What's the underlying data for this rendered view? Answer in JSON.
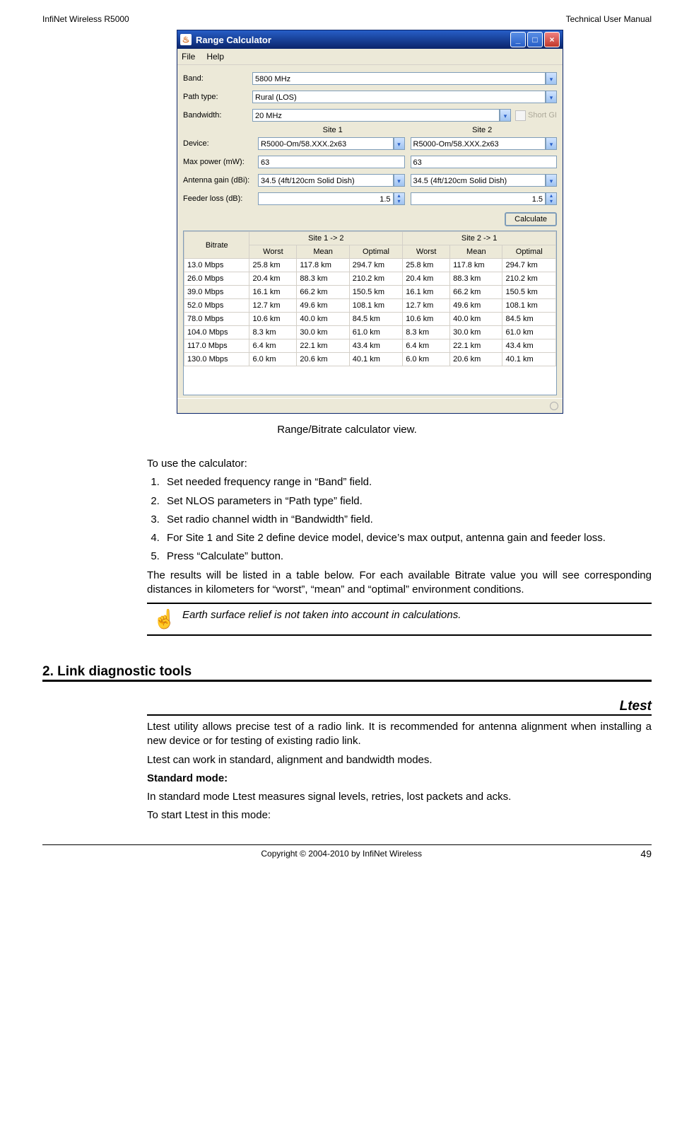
{
  "header": {
    "left": "InfiNet Wireless R5000",
    "right": "Technical User Manual"
  },
  "footer": {
    "center": "Copyright © 2004-2010 by InfiNet Wireless",
    "page": "49"
  },
  "calc_window": {
    "title": "Range Calculator",
    "menu": {
      "file": "File",
      "help": "Help"
    },
    "labels": {
      "band": "Band:",
      "path": "Path type:",
      "bw": "Bandwidth:",
      "short_gi": "Short GI",
      "site1": "Site 1",
      "site2": "Site 2",
      "device": "Device:",
      "maxpower": "Max power (mW):",
      "antgain": "Antenna gain (dBi):",
      "feeder": "Feeder loss (dB):",
      "calculate": "Calculate"
    },
    "values": {
      "band": "5800 MHz",
      "path": "Rural (LOS)",
      "bw": "20 MHz",
      "device1": "R5000-Om/58.XXX.2x63",
      "device2": "R5000-Om/58.XXX.2x63",
      "power1": "63",
      "power2": "63",
      "ant1": "34.5 (4ft/120cm Solid Dish)",
      "ant2": "34.5 (4ft/120cm Solid Dish)",
      "feeder1": "1.5",
      "feeder2": "1.5"
    },
    "table_headers": {
      "bitrate": "Bitrate",
      "s12": "Site 1 -> 2",
      "s21": "Site 2 -> 1",
      "worst": "Worst",
      "mean": "Mean",
      "optimal": "Optimal"
    }
  },
  "chart_data": {
    "type": "table",
    "columns": [
      "Bitrate",
      "S12 Worst",
      "S12 Mean",
      "S12 Optimal",
      "S21 Worst",
      "S21 Mean",
      "S21 Optimal"
    ],
    "rows": [
      {
        "bitrate": "13.0 Mbps",
        "w1": "25.8 km",
        "m1": "117.8 km",
        "o1": "294.7 km",
        "w2": "25.8 km",
        "m2": "117.8 km",
        "o2": "294.7 km"
      },
      {
        "bitrate": "26.0 Mbps",
        "w1": "20.4 km",
        "m1": "88.3 km",
        "o1": "210.2 km",
        "w2": "20.4 km",
        "m2": "88.3 km",
        "o2": "210.2 km"
      },
      {
        "bitrate": "39.0 Mbps",
        "w1": "16.1 km",
        "m1": "66.2 km",
        "o1": "150.5 km",
        "w2": "16.1 km",
        "m2": "66.2 km",
        "o2": "150.5 km"
      },
      {
        "bitrate": "52.0 Mbps",
        "w1": "12.7 km",
        "m1": "49.6 km",
        "o1": "108.1 km",
        "w2": "12.7 km",
        "m2": "49.6 km",
        "o2": "108.1 km"
      },
      {
        "bitrate": "78.0 Mbps",
        "w1": "10.6 km",
        "m1": "40.0 km",
        "o1": "84.5 km",
        "w2": "10.6 km",
        "m2": "40.0 km",
        "o2": "84.5 km"
      },
      {
        "bitrate": "104.0 Mbps",
        "w1": "8.3 km",
        "m1": "30.0 km",
        "o1": "61.0 km",
        "w2": "8.3 km",
        "m2": "30.0 km",
        "o2": "61.0 km"
      },
      {
        "bitrate": "117.0 Mbps",
        "w1": "6.4 km",
        "m1": "22.1 km",
        "o1": "43.4 km",
        "w2": "6.4 km",
        "m2": "22.1 km",
        "o2": "43.4 km"
      },
      {
        "bitrate": "130.0 Mbps",
        "w1": "6.0 km",
        "m1": "20.6 km",
        "o1": "40.1 km",
        "w2": "6.0 km",
        "m2": "20.6 km",
        "o2": "40.1 km"
      }
    ]
  },
  "caption": "Range/Bitrate calculator view.",
  "instructions": {
    "intro": "To use the calculator:",
    "steps": [
      "Set needed frequency range in “Band” field.",
      "Set NLOS parameters in “Path type” field.",
      "Set radio channel width in “Bandwidth” field.",
      "For Site 1 and Site 2 define device model, device’s max output, antenna gain and feeder loss.",
      "Press “Calculate” button."
    ],
    "results": "The results will be listed in a table below. For each available Bitrate value you will see corresponding distances in kilometers for “worst”, “mean” and “optimal” environment conditions.",
    "note": "Earth surface relief is not taken into account in calculations."
  },
  "section2": {
    "title": "2. Link diagnostic tools",
    "sub": "Ltest",
    "p1": "Ltest utility allows precise test of a radio link. It is recommended for antenna alignment when installing a new device or for testing of existing radio link.",
    "p2": "Ltest can work in standard, alignment and bandwidth modes.",
    "p3": "Standard mode:",
    "p4": "In standard mode Ltest measures signal levels, retries, lost packets and acks.",
    "p5": "To start Ltest in this mode:"
  }
}
